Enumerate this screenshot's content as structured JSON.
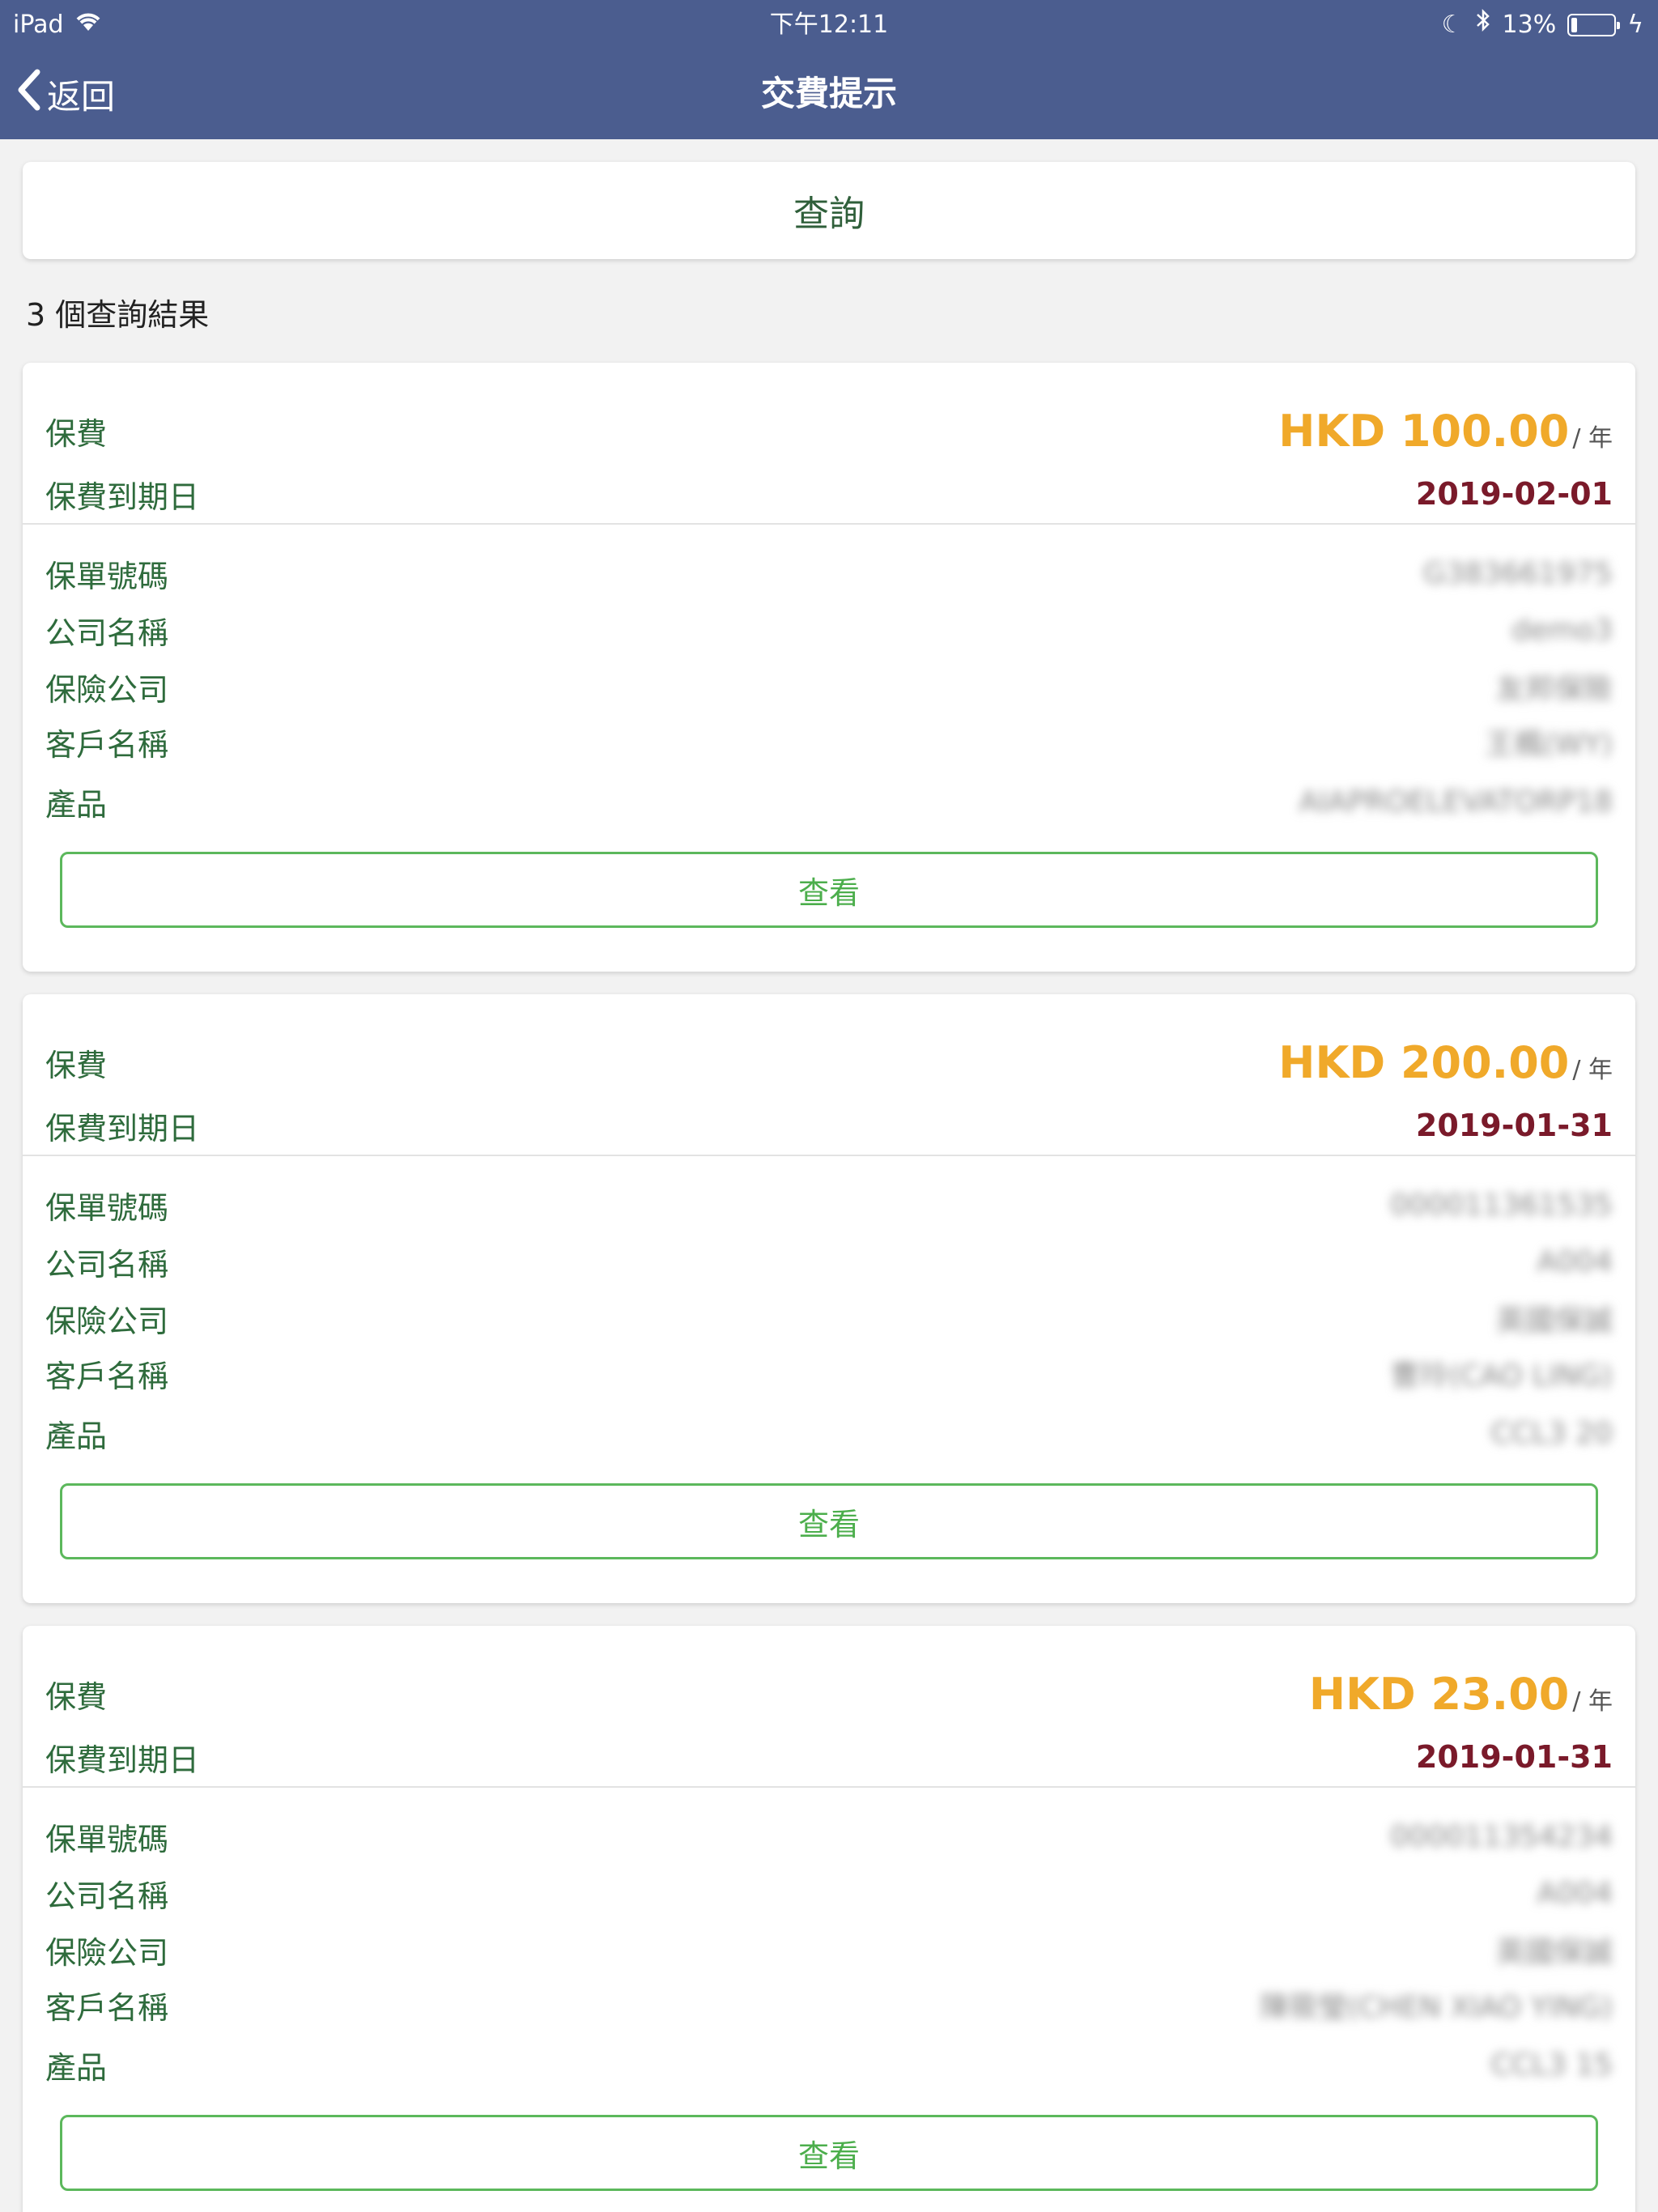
{
  "status_bar": {
    "device": "iPad",
    "time": "下午12:11",
    "battery_text": "13%",
    "battery_level": 0.13
  },
  "nav": {
    "back_label": "返回",
    "title": "交費提示"
  },
  "search": {
    "label": "查詢"
  },
  "results": {
    "count_text": "3 個查詢結果"
  },
  "labels": {
    "premium": "保費",
    "due_date": "保費到期日",
    "policy_no": "保單號碼",
    "company": "公司名稱",
    "insurer": "保險公司",
    "customer": "客戶名稱",
    "product": "產品",
    "view": "查看"
  },
  "policies": [
    {
      "amount": "HKD 100.00",
      "unit": "/ 年",
      "due": "2019-02-01",
      "policy_no": "G383661975",
      "company": "demo3",
      "insurer": "友邦保險",
      "customer": "王楓(WY)",
      "product": "AIAPROELEVATORP18"
    },
    {
      "amount": "HKD 200.00",
      "unit": "/ 年",
      "due": "2019-01-31",
      "policy_no": "000011361535",
      "company": "A004",
      "insurer": "英國保誠",
      "customer": "曹玲(CAO LING)",
      "product": "CCL3 20"
    },
    {
      "amount": "HKD 23.00",
      "unit": "/ 年",
      "due": "2019-01-31",
      "policy_no": "000011354234",
      "company": "A004",
      "insurer": "英國保誠",
      "customer": "陳筱瑩(CHEN XIAO YING)",
      "product": "CCL3 15"
    }
  ],
  "colors": {
    "nav_bg": "#4b5d8f",
    "accent_amount": "#f0a92a",
    "due_color": "#7a1a2a",
    "label_green": "#2e6b3c",
    "button_green": "#5cb85c"
  }
}
